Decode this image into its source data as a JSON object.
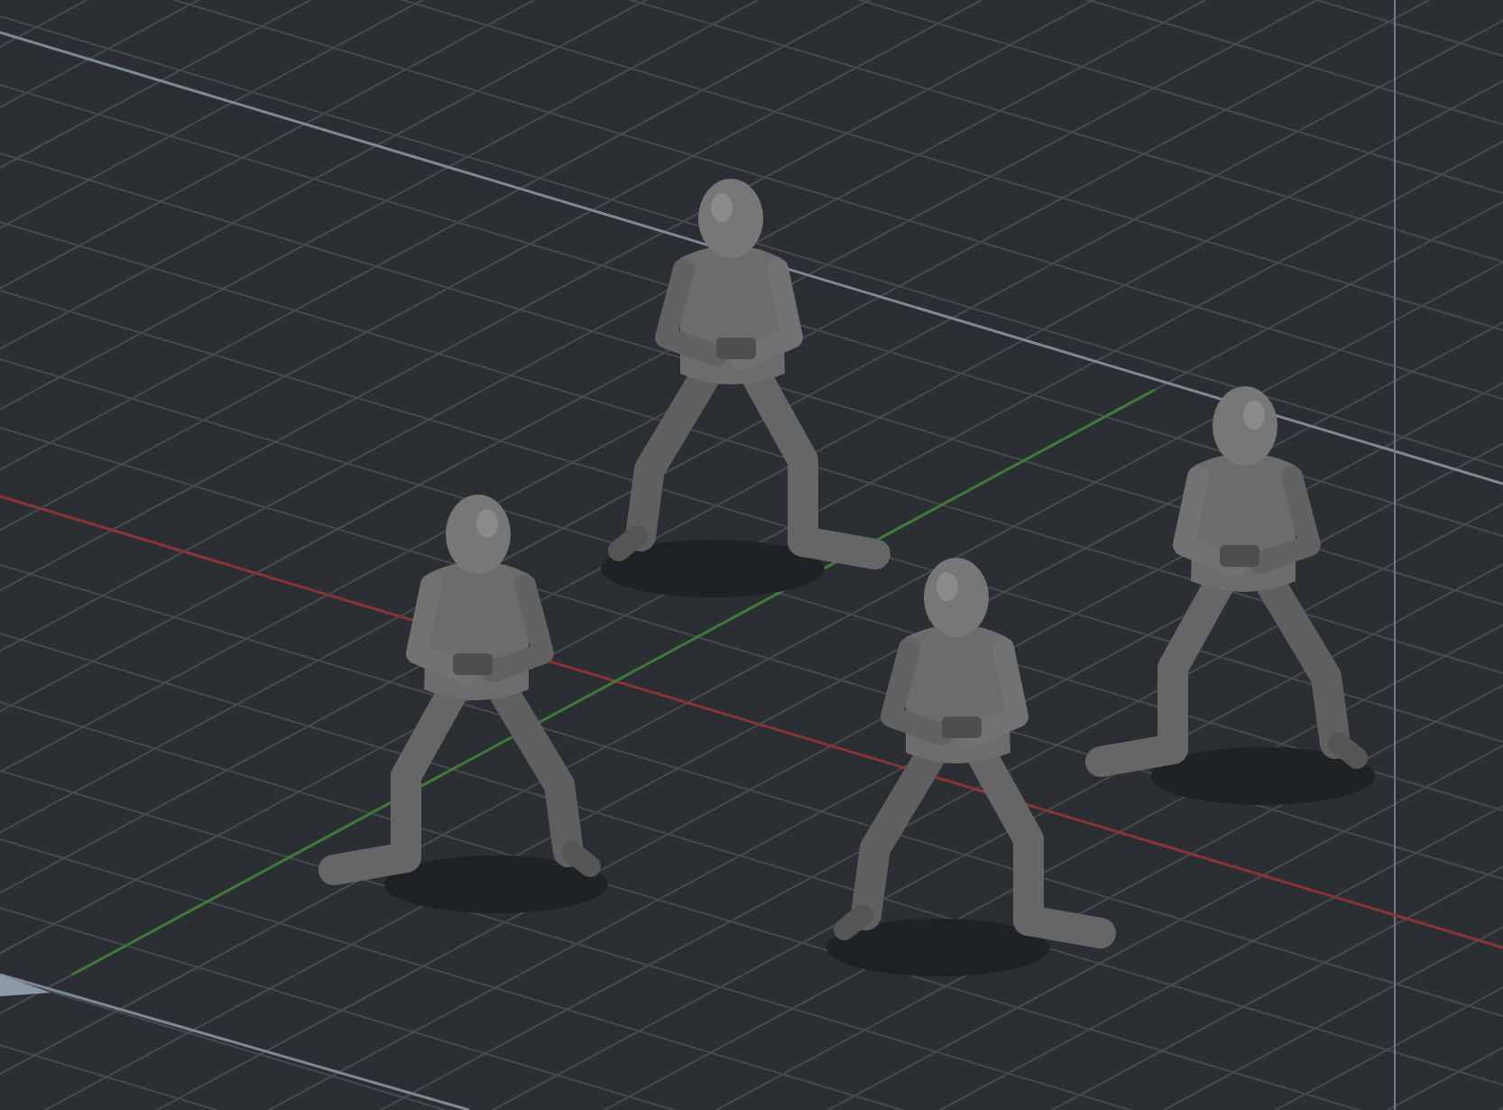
{
  "viewport": {
    "figures": [
      {
        "kind": "kneeling"
      },
      {
        "kind": "kneeling"
      },
      {
        "kind": "kneeling"
      },
      {
        "kind": "kneeling"
      }
    ]
  }
}
